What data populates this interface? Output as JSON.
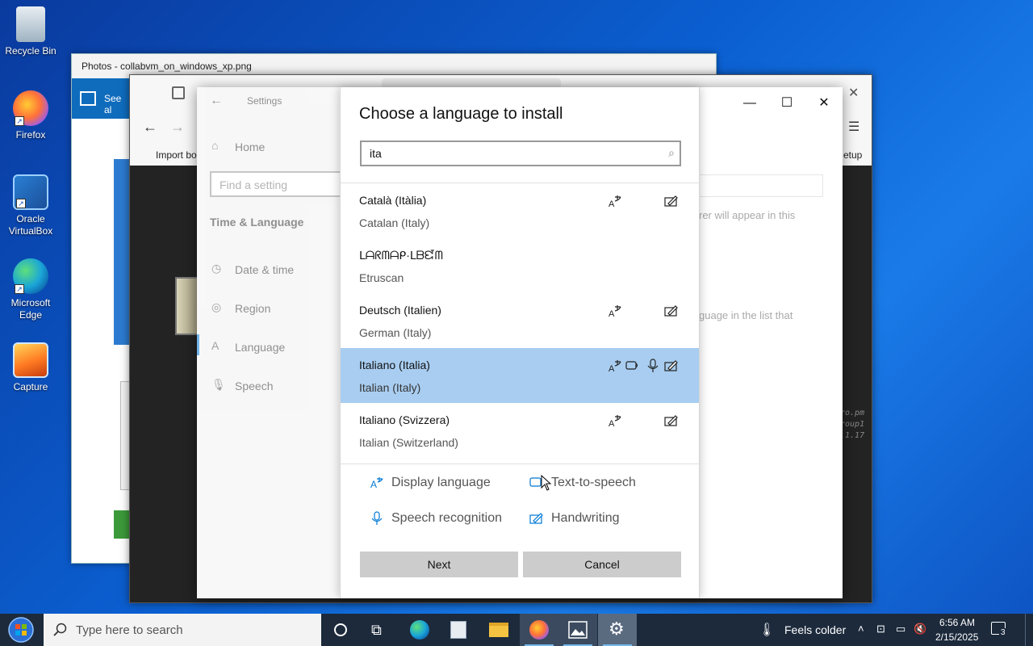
{
  "desktop": {
    "icons": [
      {
        "label": "Recycle Bin"
      },
      {
        "label": "Firefox"
      },
      {
        "label": "Oracle VirtualBox"
      },
      {
        "label": "Microsoft Edge"
      },
      {
        "label": "Capture"
      }
    ]
  },
  "photos_window": {
    "title": "Photos - collabvm_on_windows_xp.png",
    "see_all": "See al"
  },
  "browser_window": {
    "import_label": "Import bo",
    "setup_label": "etup",
    "hint_text_1": "rer will appear in this",
    "hint_text_2": "guage in the list that",
    "terminal_lines": [
      "ro.pm",
      "roup1",
      ".1.17"
    ]
  },
  "settings": {
    "title": "Settings",
    "home": "Home",
    "find_placeholder": "Find a setting",
    "section": "Time & Language",
    "nav": [
      {
        "label": "Date & time"
      },
      {
        "label": "Region"
      },
      {
        "label": "Language"
      },
      {
        "label": "Speech"
      }
    ]
  },
  "dialog": {
    "title": "Choose a language to install",
    "search_value": "ita",
    "languages": [
      {
        "native": "Català (Itàlia)",
        "english": "Catalan (Italy)",
        "features": [
          "display-language",
          "handwriting"
        ],
        "selected": false
      },
      {
        "native": "ᒪᗩᖇᗰᗩᑭ·ᒪᗷᘿᗰ",
        "english": "Etruscan",
        "features": [],
        "selected": false
      },
      {
        "native": "Deutsch (Italien)",
        "english": "German (Italy)",
        "features": [
          "display-language",
          "handwriting"
        ],
        "selected": false
      },
      {
        "native": "Italiano (Italia)",
        "english": "Italian (Italy)",
        "features": [
          "display-language",
          "text-to-speech",
          "speech-recognition",
          "handwriting"
        ],
        "selected": true
      },
      {
        "native": "Italiano (Svizzera)",
        "english": "Italian (Switzerland)",
        "features": [
          "display-language",
          "handwriting"
        ],
        "selected": false
      }
    ],
    "legend": {
      "display_language": "Display language",
      "text_to_speech": "Text-to-speech",
      "speech_recognition": "Speech recognition",
      "handwriting": "Handwriting"
    },
    "next_label": "Next",
    "cancel_label": "Cancel"
  },
  "taskbar": {
    "search_placeholder": "Type here to search",
    "weather": "Feels colder",
    "time": "6:56 AM",
    "date": "2/15/2025",
    "notification_count": "3"
  },
  "colors": {
    "selected_row": "#a8cdf0",
    "accent": "#0078d4",
    "button_bg": "#cccccc"
  }
}
